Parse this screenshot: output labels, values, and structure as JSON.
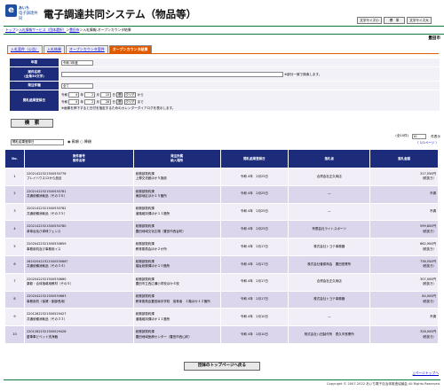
{
  "header": {
    "logo_mark": "e",
    "logo_line1": "あいち",
    "logo_line2": "电子調達共同",
    "title": "電子調達共同システム（物品等）",
    "font_small": "文字サイズ小",
    "font_standard": "標　準",
    "font_large": "文字サイズ大"
  },
  "breadcrumb": [
    "トップ",
    "入札情報サービス（団体選択）",
    "豊田市",
    "入札情報-オープンカウンタ結果"
  ],
  "breadcrumb_sep": "＞",
  "city": "豊田市",
  "tabs": [
    "入札案件（公告）",
    "入札結果",
    "オープンカウンタ案件",
    "オープンカウンタ結果"
  ],
  "form": {
    "fiscal_year_label": "年度",
    "fiscal_year_value": "令和 3年度",
    "case_name_label": "案件名称",
    "case_name_sub": "(全角50文字)",
    "case_name_hint": "※部分一致で検索します。",
    "method_label": "発注件種",
    "method_value": "全て",
    "date_label": "開札結果登録日",
    "era": "令和",
    "from": {
      "y": "4",
      "m": "2",
      "d": "10"
    },
    "to": {
      "y": "4",
      "m": "2",
      "d": "28"
    },
    "year_unit": "年",
    "month_unit": "月",
    "day_unit": "日",
    "cal_btn": "暦",
    "clear_btn": "クリア",
    "kara": "から",
    "made": "まで",
    "cal_hint": "※画像を押下すると日付を指定するためのカレンダーダイアログを表示します。"
  },
  "search_button": "検　索",
  "sort": {
    "select_value": "開札結果登録日",
    "asc": "昇順",
    "desc": "降順"
  },
  "count": "(全10件)",
  "per_page": "10",
  "per_page_label": "件表示",
  "pager": "〈 1/1ページ 〉",
  "table": {
    "headers": {
      "no": "No.",
      "case": "案件番号\n案件名称",
      "dept": "発注所属\n納入場所",
      "date": "開札結果登録日",
      "winner": "落札者",
      "amount": "落札金額"
    },
    "rows": [
      {
        "no": "1",
        "id": "22021422321500530776",
        "name": "プレイハウス12から品目",
        "dept": "総務部契約課",
        "place": "上郷交流館ほか５施設",
        "date": "令和 4年　2月25日",
        "winner": "合資会社正久商店",
        "amount": "317,550円",
        "tax": "（税抜き）"
      },
      {
        "no": "2",
        "id": "22021422321500530781",
        "name": "共通依頼消耗品（その３６）",
        "dept": "総務部契約課",
        "place": "東部地区ほか１５箇所",
        "date": "令和 4年　2月25日",
        "winner": "―",
        "amount": "不調",
        "tax": ""
      },
      {
        "no": "3",
        "id": "22021422321500530782",
        "name": "共通依頼消耗品（その３５）",
        "dept": "総務部契約課",
        "place": "道路維持課ほか１１箇所",
        "date": "令和 4年　2月25日",
        "winner": "―",
        "amount": "不調",
        "tax": ""
      },
      {
        "no": "4",
        "id": "22021422321500530780",
        "name": "卓球台及び卓球フェンス",
        "dept": "総務部契約課",
        "place": "豊田地域文化広場（豊田市西谷町）",
        "date": "令和 4年　2月25日",
        "winner": "有限会社ライトスポーツ",
        "amount": "599,800円",
        "tax": "（税抜き）"
      },
      {
        "no": "5",
        "id": "22020422321500530659",
        "name": "事務用机及び事務用イス",
        "dept": "総務部契約課",
        "place": "教育委員会ほか２か所",
        "date": "令和 4年　2月17日",
        "winner": "株式会社トヨテ事務器",
        "amount": "662,900円",
        "tax": "（税抜き）"
      },
      {
        "no": "6",
        "id": "26202042232150053066？",
        "name": "共通依頼消耗品（その３４）",
        "dept": "総務部契約課",
        "place": "福祉総務課ほか１０箇所",
        "date": "令和 4年　2月17日",
        "winner": "株式会社菅原商会　豊田営業所",
        "amount": "738,550円",
        "tax": "（税抜き）"
      },
      {
        "no": "7",
        "id": "22020422321500530660",
        "name": "薬箭・合体指導用教材（その５）",
        "dept": "総務部契約課",
        "place": "豊田市立西広瀬小学校ほか４校",
        "date": "令和 4年　2月17日",
        "winner": "合資会社正久商店",
        "amount": "307,000円",
        "tax": "（税抜き）"
      },
      {
        "no": "8",
        "id": "22020422321500530663",
        "name": "事務用机（保健・副部長用）",
        "dept": "総務部契約課",
        "place": "教育委員会豊田南中学校　保育者　１階ほか１２箇所",
        "date": "令和 4年　2月17日",
        "winner": "株式会社トヨテ事務器",
        "amount": "84,000円",
        "tax": "（税抜き）"
      },
      {
        "no": "9",
        "id": "22012822321500529427",
        "name": "共通依頼消耗品（その３３）",
        "dept": "総務部契約課",
        "place": "道路維持課ほか１１箇所",
        "date": "令和 4年　2月10日",
        "winner": "―",
        "amount": "不調",
        "tax": ""
      },
      {
        "no": "10",
        "id": "22012822321500529428",
        "name": "屋車車ビベット洗浄器",
        "dept": "総務部契約課",
        "place": "豊田地域医療センター（豊田市西山町）",
        "date": "令和 4年　2月10日",
        "winner": "株式会社八田製作所　表久市営業所",
        "amount": "328,000円",
        "tax": "（税抜き）"
      }
    ]
  },
  "back_button": "団体のトップページへ戻る",
  "to_top": "△ページトップへ",
  "footer": "Copyright © 2007-2022 あいち電子自治体推進協議会 All Rights Reserved."
}
